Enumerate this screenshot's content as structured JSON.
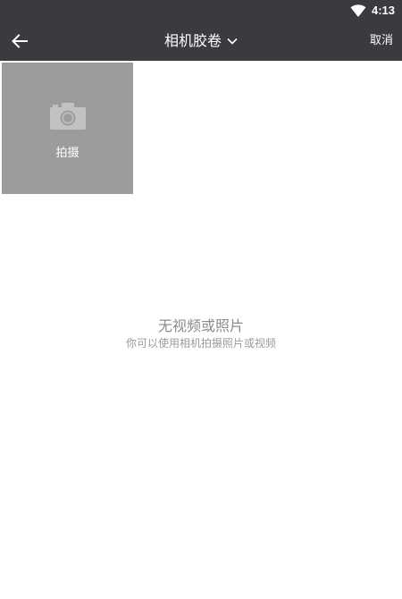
{
  "status_bar": {
    "time": "4:13",
    "icons": [
      "wifi-icon"
    ]
  },
  "toolbar": {
    "back_icon": "arrow-left-icon",
    "album_title": "相机胶卷",
    "dropdown_icon": "chevron-down-icon",
    "cancel_label": "取消"
  },
  "grid": {
    "capture_tile": {
      "icon": "camera-icon",
      "label": "拍摄"
    }
  },
  "empty_state": {
    "title": "无视频或照片",
    "subtitle": "你可以使用相机拍摄照片或视频"
  },
  "colors": {
    "toolbar_bg": "#3a3b3e",
    "tile_bg": "#9c9c9c",
    "empty_text": "#8c8c8c"
  }
}
